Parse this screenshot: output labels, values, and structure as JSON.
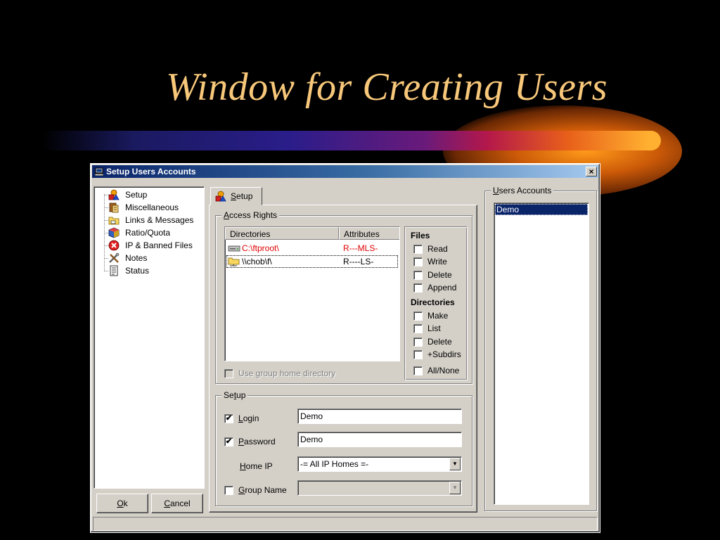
{
  "slide": {
    "title": "Window for Creating Users"
  },
  "window": {
    "title": "Setup Users Accounts",
    "close_glyph": "×"
  },
  "tree": {
    "items": [
      {
        "label": "Setup",
        "icon": "setup-shapes-icon"
      },
      {
        "label": "Miscellaneous",
        "icon": "miscellaneous-book-icon"
      },
      {
        "label": "Links & Messages",
        "icon": "links-folder-icon"
      },
      {
        "label": "Ratio/Quota",
        "icon": "ratio-cube-icon"
      },
      {
        "label": "IP & Banned Files",
        "icon": "banned-red-x-icon"
      },
      {
        "label": "Notes",
        "icon": "notes-tools-icon"
      },
      {
        "label": "Status",
        "icon": "status-document-icon"
      }
    ]
  },
  "buttons": {
    "ok": {
      "mnemonic": "O",
      "rest": "k"
    },
    "cancel": {
      "mnemonic": "C",
      "rest": "ancel"
    }
  },
  "tab": {
    "mnemonic": "S",
    "rest": "etup"
  },
  "access_rights": {
    "legend_mnemonic": "A",
    "legend_rest": "ccess Rights",
    "columns": [
      "Directories",
      "Attributes"
    ],
    "rows": [
      {
        "path": "C:\\ftproot\\",
        "attributes": "R---MLS-",
        "color": "#e00000",
        "icon": "drive-icon"
      },
      {
        "path": "\\\\chob\\f\\",
        "attributes": "R----LS-",
        "color": "#000000",
        "icon": "network-folder-icon"
      }
    ],
    "use_group_home": {
      "label": "Use group home directory",
      "checked": false,
      "disabled": true
    }
  },
  "files": {
    "title": "Files",
    "options": [
      {
        "label": "Read",
        "checked": false
      },
      {
        "label": "Write",
        "checked": false
      },
      {
        "label": "Delete",
        "checked": false
      },
      {
        "label": "Append",
        "checked": false
      }
    ]
  },
  "directories": {
    "title": "Directories",
    "options": [
      {
        "label": "Make",
        "checked": false
      },
      {
        "label": "List",
        "checked": false
      },
      {
        "label": "Delete",
        "checked": false
      },
      {
        "label": "+Subdirs",
        "checked": false
      }
    ],
    "all_none": {
      "label": "All/None",
      "checked": false
    }
  },
  "setup_group": {
    "legend_pre": "Se",
    "legend_mnemonic": "t",
    "legend_rest": "up",
    "login": {
      "mnemonic": "L",
      "rest": "ogin",
      "checked": true,
      "check_glyph": "✔",
      "value": "Demo"
    },
    "password": {
      "mnemonic": "P",
      "rest": "assword",
      "checked": true,
      "check_glyph": "✔",
      "value": "Demo"
    },
    "home_ip": {
      "mnemonic": "H",
      "rest": "ome IP",
      "value": "-= All IP Homes =-"
    },
    "group_name": {
      "mnemonic": "G",
      "rest": "roup Name",
      "checked": false,
      "value": ""
    },
    "dropdown_glyph": "▼"
  },
  "users_accounts": {
    "legend_mnemonic": "U",
    "legend_rest": "sers Accounts",
    "items": [
      {
        "label": "Demo",
        "selected": true
      }
    ]
  },
  "colors": {
    "title_text": "#f7c77a",
    "window_face": "#d4d0c8",
    "titlebar_start": "#0a246a",
    "titlebar_end": "#a6caf0",
    "selection": "#0a246a",
    "red_path": "#e00000"
  }
}
